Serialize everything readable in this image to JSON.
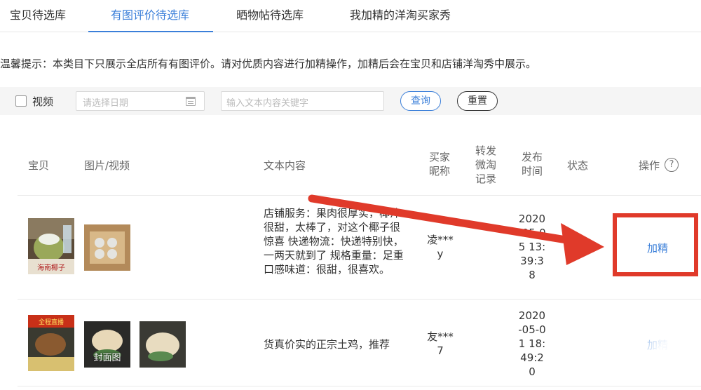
{
  "tabs": [
    {
      "label": "宝贝待选库",
      "active": false
    },
    {
      "label": "有图评价待选库",
      "active": true
    },
    {
      "label": "晒物帖待选库",
      "active": false
    },
    {
      "label": "我加精的洋淘买家秀",
      "active": false
    }
  ],
  "tip": "温馨提示：本类目下只展示全店所有有图评价。请对优质内容进行加精操作，加精后会在宝贝和店铺洋淘秀中展示。",
  "filter": {
    "video_label": "视频",
    "date_placeholder": "请选择日期",
    "keyword_placeholder": "输入文本内容关键字",
    "query_label": "查询",
    "reset_label": "重置"
  },
  "table": {
    "headers": {
      "item": "宝贝",
      "media": "图片/视频",
      "text": "文本内容",
      "nick": "买家\n昵称",
      "repost": "转发\n微淘\n记录",
      "time": "发布\n时间",
      "status": "状态",
      "action": "操作"
    },
    "help_icon": "?",
    "rows": [
      {
        "text": "店铺服务：果肉很厚实，椰汁很甜，太棒了，对这个椰子很惊喜 快递物流：快递特别快，一两天就到了 规格重量：足重 口感味道：很甜，很喜欢。",
        "nick": "凌***y",
        "time": "2020-05-05 13:39:38",
        "action": "加精",
        "product_label": "海南椰子"
      },
      {
        "text": "货真价实的正宗土鸡，推荐",
        "nick": "友***7",
        "time": "2020-05-01 18:49:20",
        "action": "加精",
        "cover_label": "封面图",
        "product_label": "全程直播"
      }
    ]
  },
  "colors": {
    "accent": "#3b7fd9",
    "annotation": "#e03a2a"
  }
}
